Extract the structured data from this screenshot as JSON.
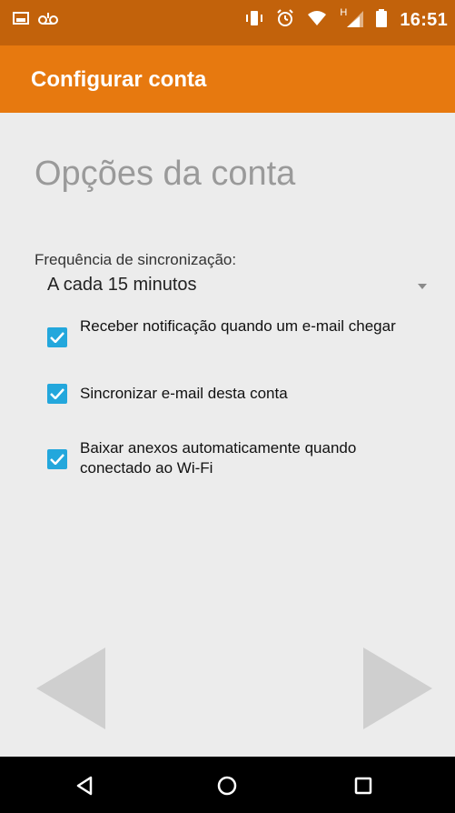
{
  "statusbar": {
    "clock": "16:51",
    "network_letter": "H",
    "icons": [
      "screenshot-icon",
      "voicemail-icon",
      "vibrate-icon",
      "alarm-icon",
      "wifi-icon",
      "signal-icon",
      "battery-icon"
    ]
  },
  "appbar": {
    "title": "Configurar conta",
    "color": "#e7790f"
  },
  "page": {
    "heading": "Opções da conta",
    "sync_label": "Frequência de sincronização:",
    "sync_value": "A cada 15 minutos"
  },
  "options": [
    {
      "label": "Receber notificação quando um e-mail chegar",
      "checked": true
    },
    {
      "label": "Sincronizar e-mail desta conta",
      "checked": true
    },
    {
      "label": "Baixar anexos automaticamente quando conectado ao Wi-Fi",
      "checked": true
    }
  ],
  "navigation": {
    "prev_icon": "back-arrow-icon",
    "next_icon": "next-arrow-icon"
  },
  "system_nav": {
    "back_icon": "back-icon",
    "home_icon": "home-icon",
    "recents_icon": "recents-icon"
  },
  "colors": {
    "accent": "#23a7dc",
    "statusbar": "#c2620b"
  }
}
